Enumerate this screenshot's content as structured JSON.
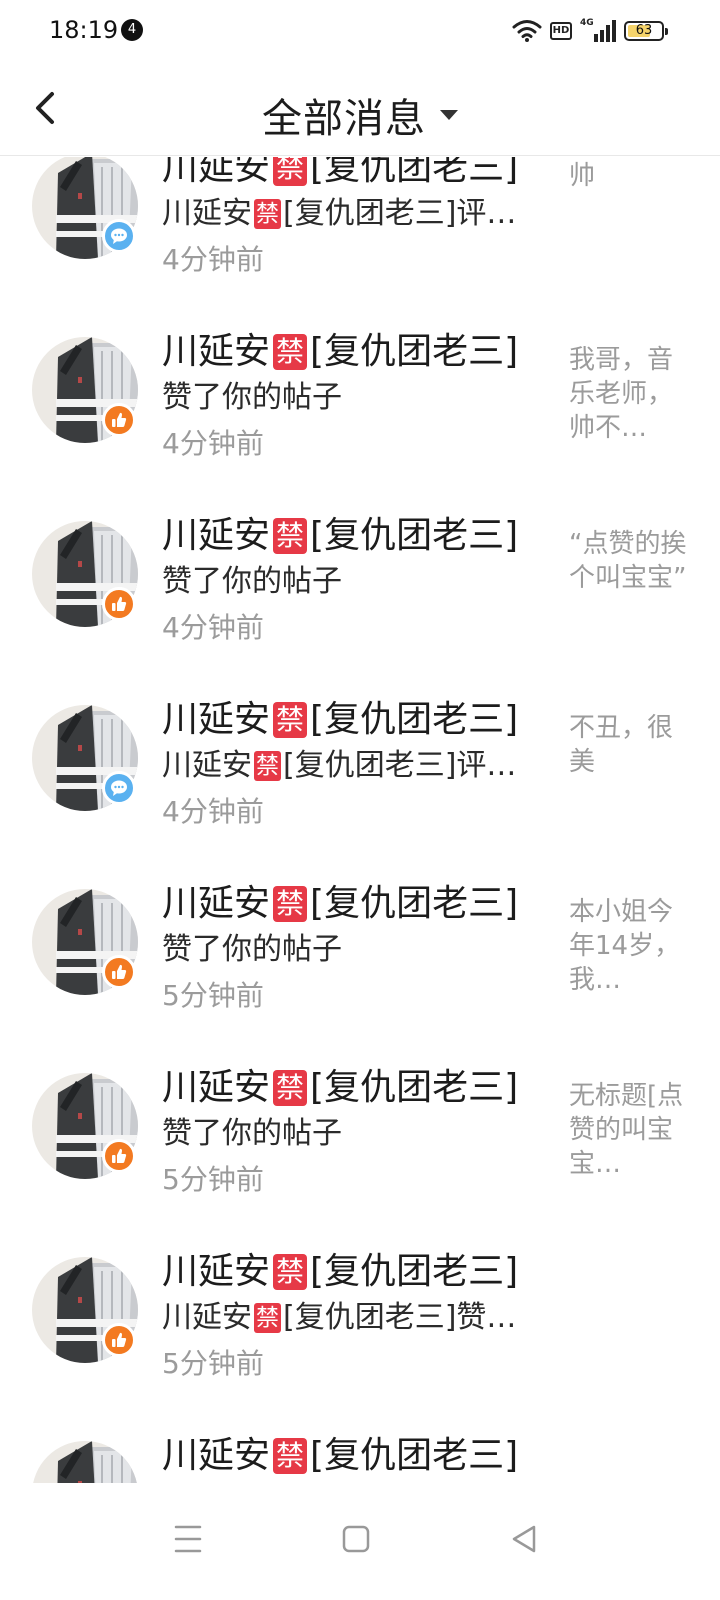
{
  "status_bar": {
    "time": "18:19",
    "notification_count": "4",
    "network_label": "HD",
    "signal_label": "4G",
    "battery": "63"
  },
  "header": {
    "title": "全部消息"
  },
  "sender": {
    "name_before": "川延安",
    "ban": "禁",
    "name_after": "[复仇团老三]"
  },
  "items": [
    {
      "type": "comment",
      "sub_before": "川延安",
      "sub_ban": "禁",
      "sub_after": "[复仇团老三]评…",
      "time": "4分钟前",
      "preview": "帅"
    },
    {
      "type": "like",
      "sub_text": "赞了你的帖子",
      "time": "4分钟前",
      "preview": "我哥，音乐老师，帅不…"
    },
    {
      "type": "like",
      "sub_text": "赞了你的帖子",
      "time": "4分钟前",
      "preview": "“点赞的挨个叫宝宝”"
    },
    {
      "type": "comment",
      "sub_before": "川延安",
      "sub_ban": "禁",
      "sub_after": "[复仇团老三]评…",
      "time": "4分钟前",
      "preview": "不丑，很美"
    },
    {
      "type": "like",
      "sub_text": "赞了你的帖子",
      "time": "5分钟前",
      "preview": "本小姐今年14岁，我…"
    },
    {
      "type": "like",
      "sub_text": "赞了你的帖子",
      "time": "5分钟前",
      "preview": "无标题[点赞的叫宝宝…"
    },
    {
      "type": "like",
      "sub_before": "川延安",
      "sub_ban": "禁",
      "sub_after": "[复仇团老三]赞…",
      "time": "5分钟前",
      "preview": ""
    },
    {
      "type": "partial",
      "time": "",
      "preview": ""
    }
  ],
  "icons": {
    "back": "chevron-left-icon",
    "dropdown": "caret-down-icon",
    "comment": "comment-bubble-icon",
    "like": "thumbs-up-icon",
    "nav_menu": "menu-icon",
    "nav_home": "home-square-icon",
    "nav_back": "back-triangle-icon"
  },
  "colors": {
    "like_badge": "#f37a21",
    "comment_badge": "#5ab1f0",
    "ban_tag": "#e63946",
    "secondary_text": "#9b9b9b"
  }
}
